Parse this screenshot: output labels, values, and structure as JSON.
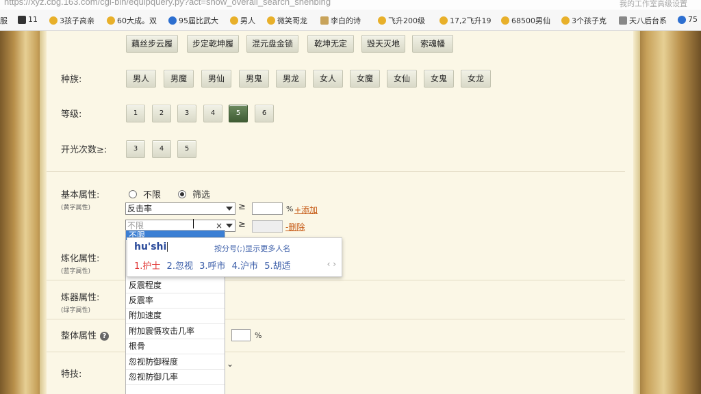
{
  "browser": {
    "url": "https://xyz.cbg.163.com/cgi-bin/equipquery.py?act=show_overall_search_shenbing",
    "right_text": "我的工作室高级设置"
  },
  "bookmarks": [
    {
      "label": "服",
      "icon": "text-fragment"
    },
    {
      "label": "11",
      "icon": "dark-icon"
    },
    {
      "label": "3孩子高亲",
      "icon": "star-icon"
    },
    {
      "label": "60大成。双",
      "icon": "star-icon"
    },
    {
      "label": "95届比武大",
      "icon": "cbg-icon"
    },
    {
      "label": "男人",
      "icon": "star-icon"
    },
    {
      "label": "微笑哥龙",
      "icon": "star-icon"
    },
    {
      "label": "李白的诗",
      "icon": "li-icon"
    },
    {
      "label": "飞升200级",
      "icon": "star-icon"
    },
    {
      "label": "17,2飞升19",
      "icon": "star-icon"
    },
    {
      "label": "68500男仙",
      "icon": "star-icon"
    },
    {
      "label": "3个孩子克",
      "icon": "star-icon"
    },
    {
      "label": "天八后台系",
      "icon": "doc-icon"
    },
    {
      "label": "75",
      "icon": "cbg-icon"
    }
  ],
  "equip_types": [
    "藕丝步云履",
    "步定乾坤履",
    "混元盘金锁",
    "乾坤无定",
    "毁天灭地",
    "索魂幡"
  ],
  "race": {
    "label": "种族:",
    "options": [
      "男人",
      "男魔",
      "男仙",
      "男鬼",
      "男龙",
      "女人",
      "女魔",
      "女仙",
      "女鬼",
      "女龙"
    ]
  },
  "level": {
    "label": "等级:",
    "options": [
      "1",
      "2",
      "3",
      "4",
      "5",
      "6"
    ],
    "selected": "5"
  },
  "kaiguang": {
    "label": "开光次数≥:",
    "options": [
      "3",
      "4",
      "5"
    ]
  },
  "basic_attr": {
    "label": "基本属性:",
    "sub": "(黄字属性)",
    "radio_unlimited": "不限",
    "radio_filter": "筛选",
    "select1_value": "反击率",
    "ge": "≥",
    "unit": "%",
    "add_link": "+添加",
    "select2_value": "不限",
    "delete_link": "-删除"
  },
  "refine_attr": {
    "label": "炼化属性:",
    "sub": "(蓝字属性)"
  },
  "forge_attr": {
    "label": "炼器属性:",
    "sub": "(绿字属性)"
  },
  "overall_attr": {
    "label": "整体属性",
    "help": "?",
    "unit": "%"
  },
  "skill": {
    "label": "特技:"
  },
  "dropdown": {
    "highlighted": "不限",
    "items": [
      "反震程度",
      "反震率",
      "附加速度",
      "附加震慑攻击几率",
      "根骨",
      "忽视防御程度",
      "忽视防御几率"
    ],
    "scroll_icon": "⌄"
  },
  "ime": {
    "pinyin": "hu'shi",
    "hint": "按分号(;)显示更多人名",
    "candidates": [
      "1.护士",
      "2.忽视",
      "3.呼市",
      "4.沪市",
      "5.胡适"
    ],
    "pager": "‹ ›"
  }
}
